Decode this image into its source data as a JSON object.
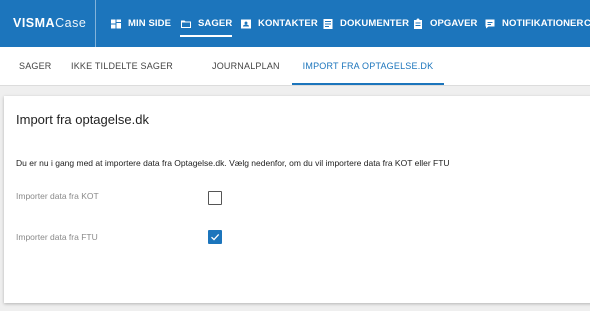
{
  "brand": {
    "part1": "VISMA",
    "part2": "Case"
  },
  "nav": [
    {
      "label": "MIN SIDE",
      "icon": "dashboard-icon"
    },
    {
      "label": "SAGER",
      "icon": "folder-icon",
      "active": true
    },
    {
      "label": "KONTAKTER",
      "icon": "contact-card-icon"
    },
    {
      "label": "DOKUMENTER",
      "icon": "document-icon"
    },
    {
      "label": "OPGAVER",
      "icon": "clipboard-icon"
    },
    {
      "label": "NOTIFIKATIONER",
      "icon": "notification-icon"
    },
    {
      "label": "C"
    }
  ],
  "subtabs": [
    {
      "label": "SAGER"
    },
    {
      "label": "IKKE TILDELTE SAGER"
    },
    {
      "label": "JOURNALPLAN"
    },
    {
      "label": "IMPORT FRA OPTAGELSE.DK",
      "active": true
    }
  ],
  "card": {
    "title": "Import fra optagelse.dk",
    "description": "Du er nu i gang med at importere data fra Optagelse.dk. Vælg nedenfor, om du vil importere data fra KOT eller FTU",
    "options": [
      {
        "label": "Importer data fra KOT",
        "checked": false
      },
      {
        "label": "Importer data fra FTU",
        "checked": true
      }
    ]
  },
  "colors": {
    "primary": "#1c75bc",
    "background": "#efefef"
  }
}
